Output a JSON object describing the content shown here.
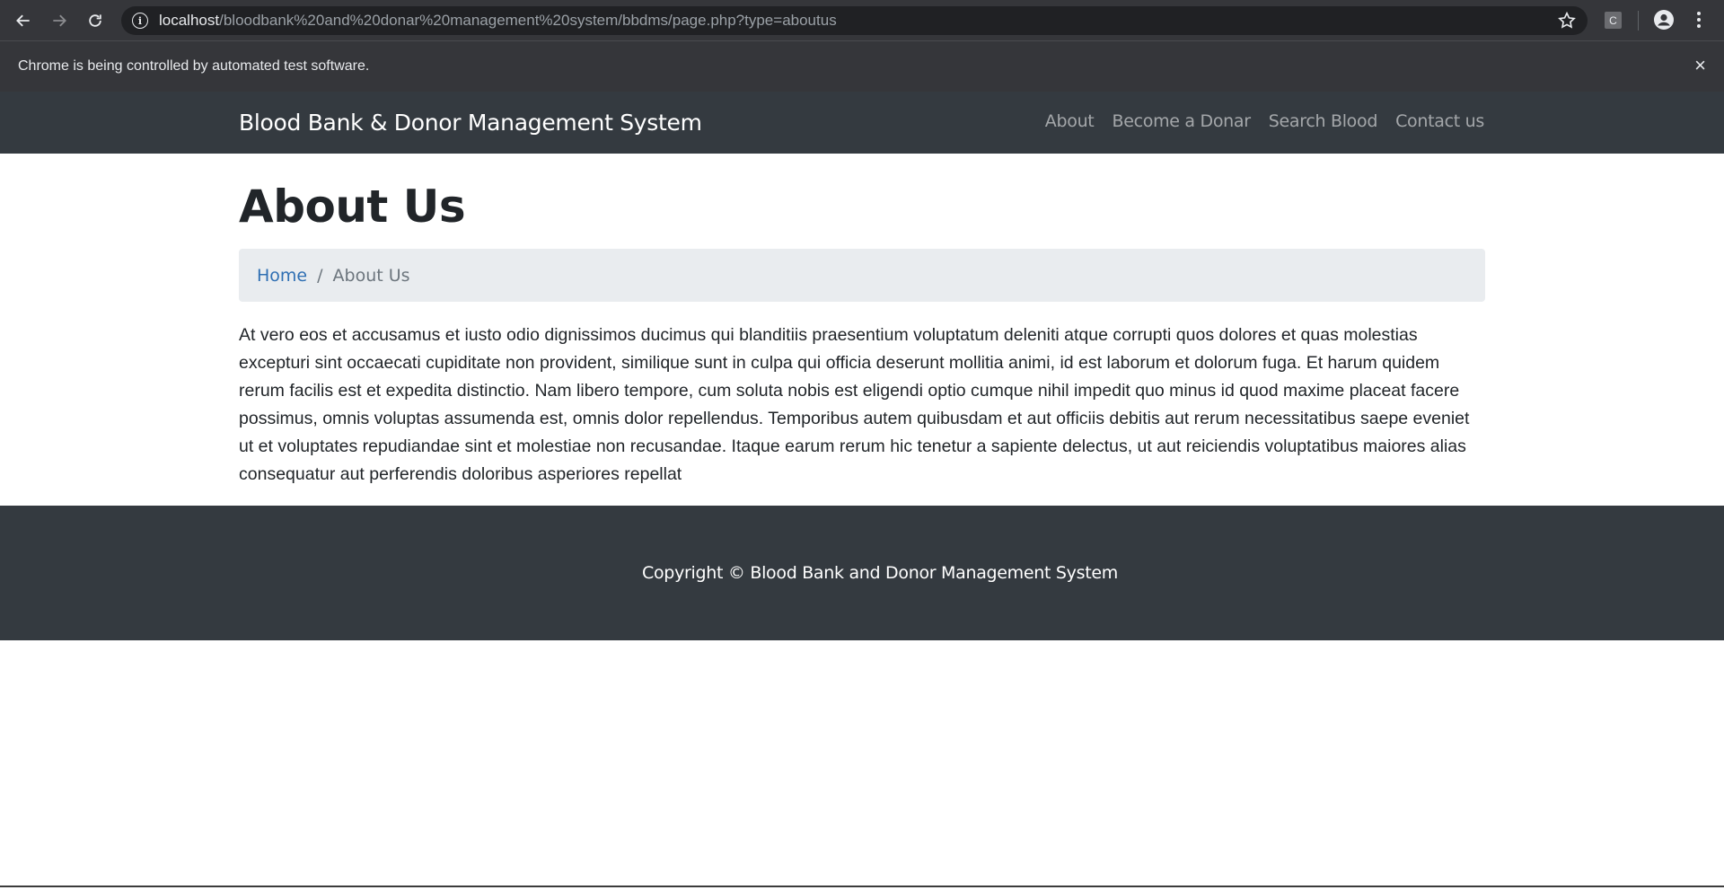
{
  "browser": {
    "url_host": "localhost",
    "url_path": "/bloodbank%20and%20donar%20management%20system/bbdms/page.php?type=aboutus",
    "extension_label": "C",
    "infobar_text": "Chrome is being controlled by automated test software.",
    "infobar_close": "×"
  },
  "navbar": {
    "brand": "Blood Bank & Donor Management System",
    "links": [
      {
        "label": "About"
      },
      {
        "label": "Become a Donar"
      },
      {
        "label": "Search Blood"
      },
      {
        "label": "Contact us"
      }
    ]
  },
  "page": {
    "title": "About Us",
    "breadcrumb": {
      "home": "Home",
      "separator": "/",
      "current": "About Us"
    },
    "body": "At vero eos et accusamus et iusto odio dignissimos ducimus qui blanditiis praesentium voluptatum deleniti atque corrupti quos dolores et quas molestias excepturi sint occaecati cupiditate non provident, similique sunt in culpa qui officia deserunt mollitia animi, id est laborum et dolorum fuga. Et harum quidem rerum facilis est et expedita distinctio. Nam libero tempore, cum soluta nobis est eligendi optio cumque nihil impedit quo minus id quod maxime placeat facere possimus, omnis voluptas assumenda est, omnis dolor repellendus. Temporibus autem quibusdam et aut officiis debitis aut rerum necessitatibus saepe eveniet ut et voluptates repudiandae sint et molestiae non recusandae. Itaque earum rerum hic tenetur a sapiente delectus, ut aut reiciendis voluptatibus maiores alias consequatur aut perferendis doloribus asperiores repellat"
  },
  "footer": {
    "copyright": "Copyright © Blood Bank and Donor Management System"
  },
  "colors": {
    "navbar_bg": "#343a40",
    "breadcrumb_bg": "#e9ecef",
    "link": "#2f6fb3",
    "browser_bg": "#35363a"
  }
}
